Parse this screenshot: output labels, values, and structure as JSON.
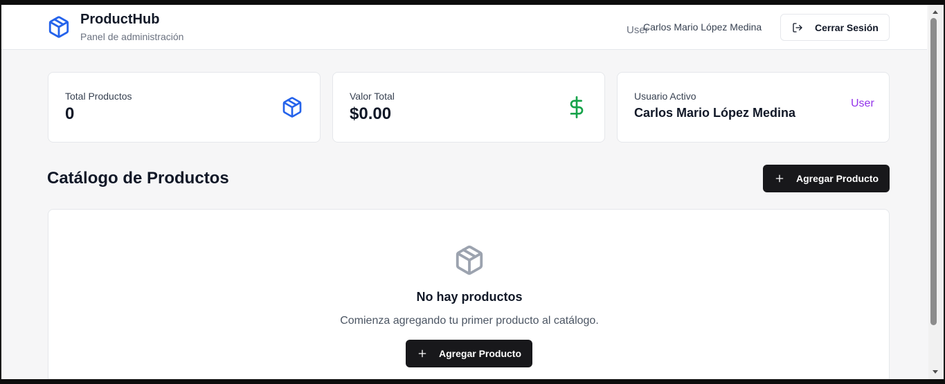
{
  "header": {
    "brand_title": "ProductHub",
    "brand_subtitle": "Panel de administración",
    "role_label": "User",
    "user_name": "Carlos Mario López Medina",
    "logout_label": "Cerrar Sesión"
  },
  "stats": {
    "total_products": {
      "caption": "Total Productos",
      "value": "0",
      "icon": "package-icon",
      "color": "#2563eb"
    },
    "total_value": {
      "caption": "Valor Total",
      "value": "$0.00",
      "icon": "dollar-icon",
      "color": "#16a34a"
    },
    "active_user": {
      "caption": "Usuario Activo",
      "value": "Carlos Mario López Medina",
      "role": "User",
      "role_color": "#9333ea"
    }
  },
  "catalog": {
    "title": "Catálogo de Productos",
    "add_label": "Agregar Producto"
  },
  "empty_state": {
    "icon": "package-icon",
    "title": "No hay productos",
    "subtitle": "Comienza agregando tu primer producto al catálogo.",
    "add_label": "Agregar Producto"
  }
}
